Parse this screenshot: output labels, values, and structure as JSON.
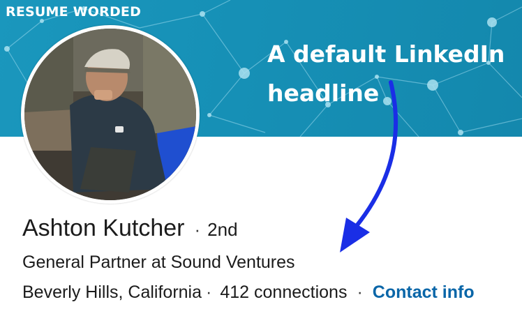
{
  "banner": {
    "brand": "RESUME WORDED",
    "annotation_line1": "A default LinkedIn",
    "annotation_line2": "headline",
    "colors": {
      "background": "#1690b6",
      "network": "#8fd6ea",
      "arrow": "#1a2ee6"
    }
  },
  "profile": {
    "avatar_icon": "profile-photo",
    "name": "Ashton Kutcher",
    "separator": "·",
    "degree": "2nd",
    "headline": "General Partner at Sound Ventures",
    "location": "Beverly Hills, California",
    "connections": "412 connections",
    "contact_label": "Contact info",
    "link_color": "#0a66a8"
  }
}
